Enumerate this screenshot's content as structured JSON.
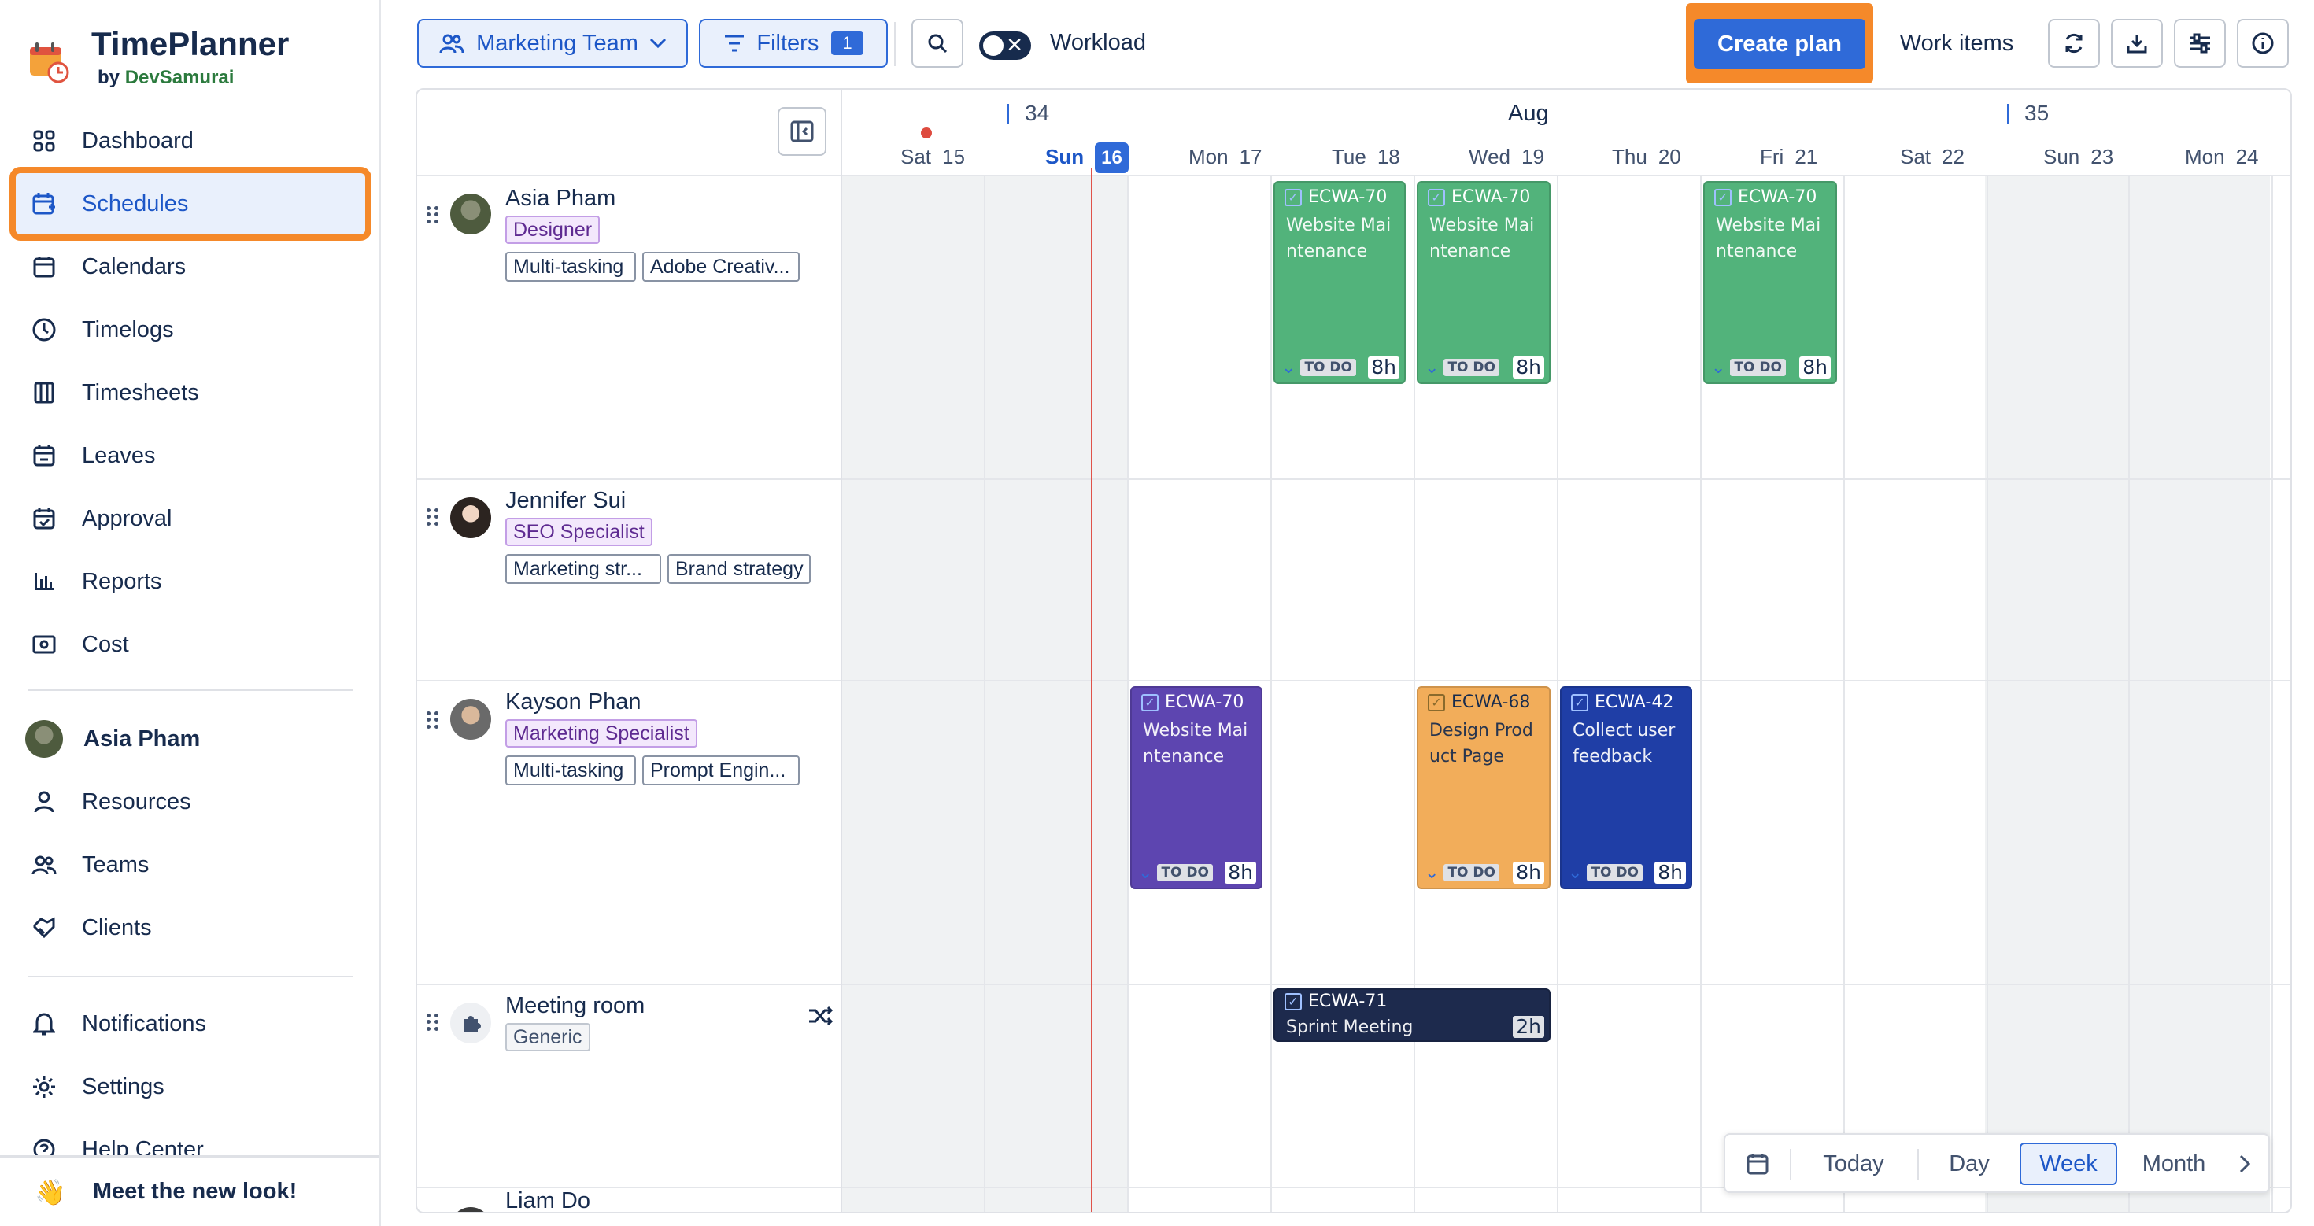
{
  "app": {
    "name": "TimePlanner",
    "by": "by",
    "company": "DevSamurai"
  },
  "nav": {
    "items": [
      {
        "label": "Dashboard"
      },
      {
        "label": "Schedules"
      },
      {
        "label": "Calendars"
      },
      {
        "label": "Timelogs"
      },
      {
        "label": "Timesheets"
      },
      {
        "label": "Leaves"
      },
      {
        "label": "Approval"
      },
      {
        "label": "Reports"
      },
      {
        "label": "Cost"
      }
    ],
    "user": "Asia Pham",
    "secondary": [
      {
        "label": "Resources"
      },
      {
        "label": "Teams"
      },
      {
        "label": "Clients"
      }
    ],
    "bottom": [
      {
        "label": "Notifications"
      },
      {
        "label": "Settings"
      },
      {
        "label": "Help Center"
      }
    ],
    "meet": "Meet the new look!",
    "active": "Schedules"
  },
  "toolbar": {
    "team": "Marketing Team",
    "filters": "Filters",
    "filter_count": "1",
    "workload": "Workload",
    "create_plan": "Create plan",
    "work_items": "Work items"
  },
  "calendar": {
    "month": "Aug",
    "weeks": [
      "34",
      "35"
    ],
    "days": [
      {
        "dow": "Sat",
        "num": "15"
      },
      {
        "dow": "Sun",
        "num": "16"
      },
      {
        "dow": "Mon",
        "num": "17"
      },
      {
        "dow": "Tue",
        "num": "18"
      },
      {
        "dow": "Wed",
        "num": "19"
      },
      {
        "dow": "Thu",
        "num": "20"
      },
      {
        "dow": "Fri",
        "num": "21"
      },
      {
        "dow": "Sat",
        "num": "22"
      },
      {
        "dow": "Sun",
        "num": "23"
      },
      {
        "dow": "Mon",
        "num": "24"
      }
    ],
    "today": "16"
  },
  "resources": [
    {
      "name": "Asia Pham",
      "role": "Designer",
      "skills": [
        "Multi-tasking",
        "Adobe Creativ..."
      ]
    },
    {
      "name": "Jennifer Sui",
      "role": "SEO Specialist",
      "skills": [
        "Marketing str...",
        "Brand strategy"
      ]
    },
    {
      "name": "Kayson Phan",
      "role": "Marketing Specialist",
      "skills": [
        "Multi-tasking",
        "Prompt Engin..."
      ]
    },
    {
      "name": "Meeting room",
      "role": "Generic",
      "skills": []
    },
    {
      "name": "Liam Do",
      "role": "",
      "skills": []
    }
  ],
  "tasks": {
    "t1": {
      "key": "ECWA-70",
      "title": "Website Maintenance",
      "status": "TO DO",
      "hours": "8h"
    },
    "t2": {
      "key": "ECWA-70",
      "title": "Website Maintenance",
      "status": "TO DO",
      "hours": "8h"
    },
    "t3": {
      "key": "ECWA-70",
      "title": "Website Maintenance",
      "status": "TO DO",
      "hours": "8h"
    },
    "t4": {
      "key": "ECWA-70",
      "title": "Website Maintenance",
      "status": "TO DO",
      "hours": "8h"
    },
    "t5": {
      "key": "ECWA-68",
      "title": "Design Product Page",
      "status": "TO DO",
      "hours": "8h"
    },
    "t6": {
      "key": "ECWA-42",
      "title": "Collect user feedback",
      "status": "TO DO",
      "hours": "8h"
    },
    "t7": {
      "key": "ECWA-71",
      "title": "Sprint Meeting",
      "status": "",
      "hours": "2h"
    }
  },
  "switcher": {
    "today": "Today",
    "day": "Day",
    "week": "Week",
    "month": "Month",
    "active": "Week"
  },
  "colors": {
    "accent": "#2f6ad8",
    "highlight": "#f5892a",
    "green": "#52b37b",
    "purple": "#5d45b0",
    "orange": "#f2ad5a",
    "navy": "#1f3ea6",
    "dark": "#1d2a4d"
  },
  "icons": [
    "dashboard-icon",
    "schedule-icon",
    "calendar-icon",
    "clock-icon",
    "timesheet-icon",
    "leave-icon",
    "approval-icon",
    "reports-icon",
    "cost-icon",
    "person-icon",
    "team-icon",
    "clients-icon",
    "bell-icon",
    "gear-icon",
    "help-icon",
    "search-icon",
    "sync-icon",
    "download-icon",
    "settings-sliders-icon",
    "info-icon"
  ]
}
